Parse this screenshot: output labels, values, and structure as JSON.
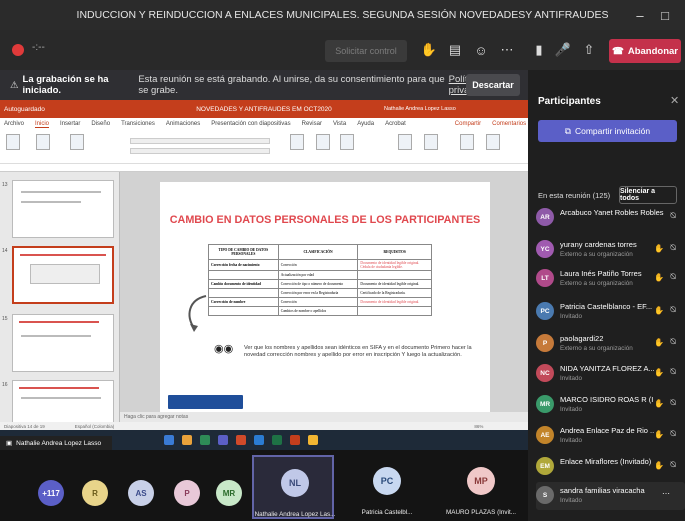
{
  "window": {
    "title": "INDUCCION Y REINDUCCION A ENLACES MUNICIPALES. SEGUNDA SESIÓN NOVEDADESY ANTIFRAUDES"
  },
  "toolbar": {
    "timer": "-:--",
    "stop_sharing": "Solicitar control",
    "leave": "Abandonar"
  },
  "banner": {
    "lead": "La grabación se ha iniciado.",
    "text": "Esta reunión se está grabando. Al unirse, da su consentimiento para que se grabe.",
    "link": "Política de privacidad",
    "dismiss": "Descartar"
  },
  "powerpoint": {
    "autosave": "Autoguardado",
    "doc_title": "NOVEDADES Y ANTIFRAUDES EM OCT2020",
    "user": "Nathalie Andrea Lopez Lasso",
    "menu": [
      "Archivo",
      "Inicio",
      "Insertar",
      "Diseño",
      "Transiciones",
      "Animaciones",
      "Presentación con diapositivas",
      "Revisar",
      "Vista",
      "Ayuda",
      "Acrobat"
    ],
    "share": "Compartir",
    "comments": "Comentarios",
    "notes_hint": "Haga clic para agregar notas",
    "status_slide": "Diapositiva 14 de 19",
    "status_lang": "Español (Colombia)",
    "zoom": "86%"
  },
  "slide": {
    "title": "CAMBIO EN DATOS PERSONALES DE LOS PARTICIPANTES",
    "table_headers": [
      "TIPO DE CAMBIO DE DATOS PERSONALES",
      "CLASIFICACIÓN",
      "REQUISITOS"
    ],
    "rows": [
      [
        "Corrección fecha de nacimiento",
        "Corrección",
        "Documento de identidad legible original. Cédula de ciudadanía legible."
      ],
      [
        "",
        "Actualización por edad",
        ""
      ],
      [
        "Cambio documento de identidad",
        "Corrección de tipo o número de documento",
        "Documento de identidad legible original."
      ],
      [
        "",
        "Corrección por error en la Registraduría",
        "Certificado de la Registraduría."
      ],
      [
        "Corrección de nombre",
        "Corrección",
        "Documento de identidad legible original."
      ],
      [
        "",
        "Cambios de nombre o apellidos",
        ""
      ]
    ],
    "note": "Ver que los nombres y apellidos sean idénticos en SIFA y en el documento Primero hacer la novedad corrección nombres y apellido por error en inscripción Y luego la actualización."
  },
  "participants": {
    "title": "Participantes",
    "invite": "Compartir invitación",
    "in_meeting": "En esta reunión (125)",
    "mute_all": "Silenciar a todos",
    "list": [
      {
        "initials": "AR",
        "name": "Arcabuco Yanet Robles Robles",
        "sub": "",
        "color": "#8e5aa8",
        "hand": false
      },
      {
        "initials": "YC",
        "name": "yurany cardenas torres",
        "sub": "Externo a su organización",
        "color": "#a05ab0",
        "hand": true
      },
      {
        "initials": "LT",
        "name": "Laura Inés Patiño Torres",
        "sub": "Externo a su organización",
        "color": "#b04a8a",
        "hand": true
      },
      {
        "initials": "PC",
        "name": "Patricia Castelblanco - EF...",
        "sub": "Invitado",
        "color": "#4a7ab0",
        "hand": true
      },
      {
        "initials": "P",
        "name": "paolagardi22",
        "sub": "Externo a su organización",
        "color": "#c67a3a",
        "hand": true
      },
      {
        "initials": "NC",
        "name": "NIDA YANITZA FLOREZ A...",
        "sub": "Invitado",
        "color": "#c24a5a",
        "hand": true
      },
      {
        "initials": "MR",
        "name": "MARCO ISIDRO ROAS R (I...",
        "sub": "Invitado",
        "color": "#3a9a6a",
        "hand": true
      },
      {
        "initials": "AE",
        "name": "Andrea Enlace Paz de Rio ...",
        "sub": "Invitado",
        "color": "#c2842a",
        "hand": true
      },
      {
        "initials": "EM",
        "name": "Enlace Miraflores (Invitado)",
        "sub": "",
        "color": "#b0a83a",
        "hand": true
      },
      {
        "initials": "S",
        "name": "sandra familias viracacha",
        "sub": "Invitado",
        "color": "#6a6a6a",
        "hand": false
      }
    ]
  },
  "presenter": {
    "name": "Nathalie Andrea Lopez Lasso"
  },
  "bottom_bar": {
    "overflow": "+117",
    "avatars": [
      {
        "initials": "R",
        "color": "#e8d48a",
        "fg": "#6a5a1a"
      },
      {
        "initials": "AS",
        "color": "#c8d0e8",
        "fg": "#3a4a8a"
      },
      {
        "initials": "P",
        "color": "#e8c8d8",
        "fg": "#8a3a5a"
      },
      {
        "initials": "MR",
        "color": "#c8e8c8",
        "fg": "#2a6a2a"
      }
    ],
    "tiles": [
      {
        "initials": "NL",
        "name": "Nathalie Andrea Lopez Las...",
        "color": "#c0c8e8",
        "fg": "#3a4a7a"
      },
      {
        "initials": "PC",
        "name": "Patricia Castelbl...",
        "color": "#c8d8f0",
        "fg": "#2a4a7a"
      },
      {
        "initials": "MP",
        "name": "MAURO PLAZAS (Invit...",
        "color": "#f0c8c8",
        "fg": "#8a3a3a"
      }
    ]
  }
}
